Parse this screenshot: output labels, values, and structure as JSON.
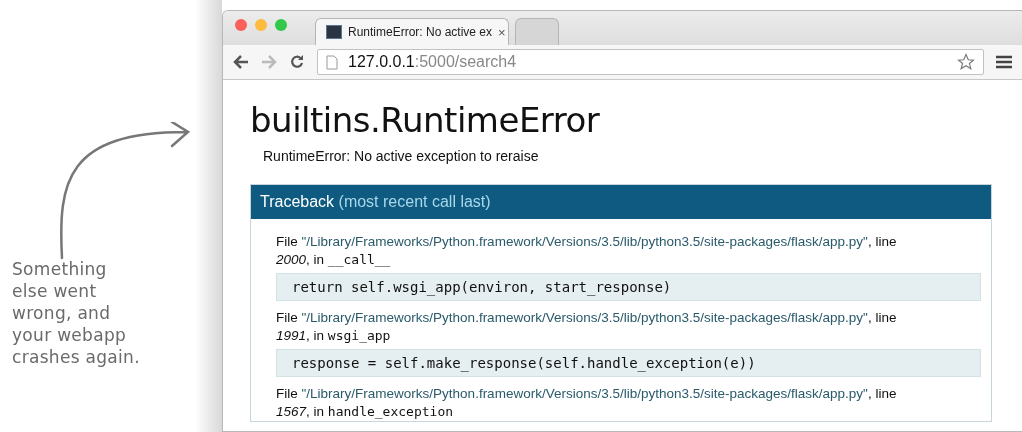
{
  "annotation": {
    "text": "Something\nelse went\nwrong, and\nyour webapp\ncrashes again."
  },
  "browser": {
    "tabs": [
      {
        "title": "RuntimeError: No active ex",
        "close": "×",
        "selected": true,
        "kind": "page"
      },
      {
        "selected": false,
        "kind": "new"
      }
    ],
    "url_host": "127.0.0.1",
    "url_path": ":5000/search4"
  },
  "page": {
    "heading": "builtins.RuntimeError",
    "message": "RuntimeError: No active exception to reraise",
    "traceback": {
      "title": "Traceback",
      "subtitle": "(most recent call last)",
      "frames": [
        {
          "file_label": "File",
          "path": "\"/Library/Frameworks/Python.framework/Versions/3.5/lib/python3.5/site-packages/flask/app.py\"",
          "line_label": ", line",
          "line": "2000",
          "in_label": ", in",
          "func": "__call__",
          "code": "return self.wsgi_app(environ, start_response)"
        },
        {
          "file_label": "File",
          "path": "\"/Library/Frameworks/Python.framework/Versions/3.5/lib/python3.5/site-packages/flask/app.py\"",
          "line_label": ", line",
          "line": "1991",
          "in_label": ", in",
          "func": "wsgi_app",
          "code": "response = self.make_response(self.handle_exception(e))"
        },
        {
          "file_label": "File",
          "path": "\"/Library/Frameworks/Python.framework/Versions/3.5/lib/python3.5/site-packages/flask/app.py\"",
          "line_label": ", line",
          "line": "1567",
          "in_label": ", in",
          "func": "handle_exception"
        }
      ]
    }
  }
}
